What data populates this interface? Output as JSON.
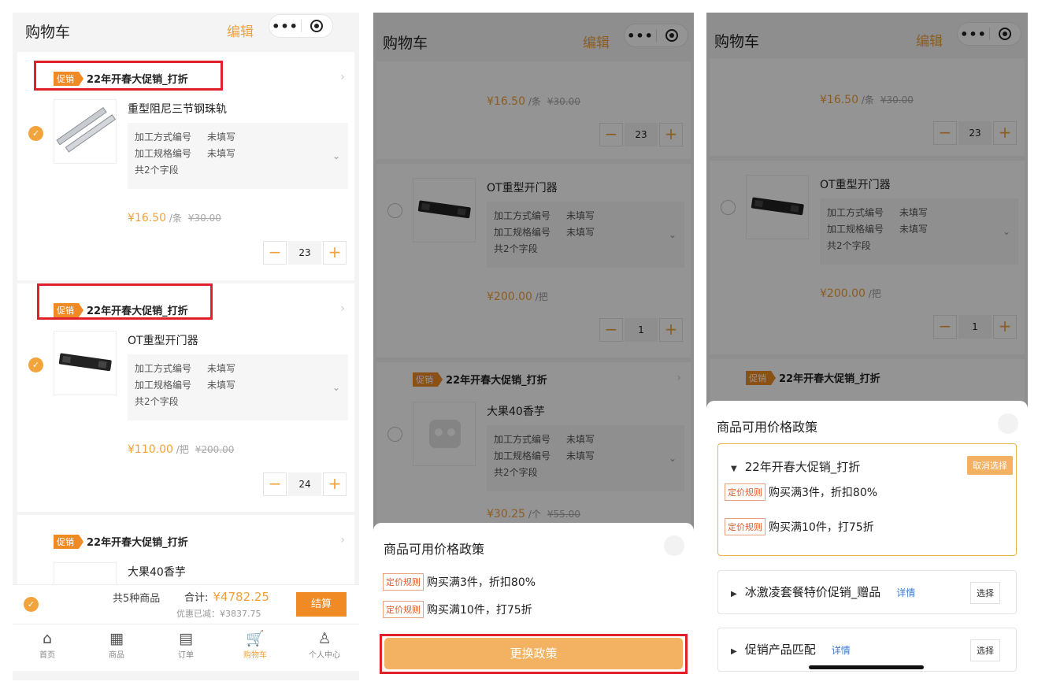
{
  "header": {
    "title": "购物车",
    "edit": "编辑",
    "more": "•••"
  },
  "promo": {
    "tag": "促销",
    "name": "22年开春大促销_打折"
  },
  "common": {
    "attr1_label": "加工方式编号",
    "attr2_label": "加工规格编号",
    "attr_value": "未填写",
    "fields_count": "共2个字段"
  },
  "items": [
    {
      "name": "重型阻尼三节钢珠轨",
      "price": "¥16.50",
      "unit": " /条",
      "old": "¥30.00",
      "qty": "23"
    },
    {
      "name": "OT重型开门器",
      "price": "¥110.00",
      "unit": " /把",
      "old": "¥200.00",
      "qty": "24"
    },
    {
      "name": "大果40香芋",
      "price": "¥30.25",
      "unit": " /个",
      "old": "¥55.00",
      "qty": ""
    }
  ],
  "p2_item2": {
    "price": "¥200.00",
    "unit": " /把",
    "qty": "1"
  },
  "footer": {
    "summary": "共5种商品",
    "total_label": "合计:",
    "total": "¥4782.25",
    "saved": "优惠已减：¥3837.75",
    "checkout": "结算"
  },
  "tabs": [
    {
      "label": "首页",
      "icon": "⌂"
    },
    {
      "label": "商品",
      "icon": "▦"
    },
    {
      "label": "订单",
      "icon": "▤"
    },
    {
      "label": "购物车",
      "icon": "🛒"
    },
    {
      "label": "个人中心",
      "icon": "♙"
    }
  ],
  "sheet": {
    "title": "商品可用价格政策",
    "rule_tag": "定价规则",
    "rule1": "购买满3件，折扣80%",
    "rule2": "购买满10件，打75折",
    "switch": "更换政策"
  },
  "policies": {
    "cancel": "取消选择",
    "choose": "选择",
    "detail": "详情",
    "p2_name": "冰激凌套餐特价促销_赠品",
    "p3_name": "促销产品匹配"
  },
  "colors": {
    "accent": "#f1a13c",
    "highlight_box": "#e0212b"
  }
}
